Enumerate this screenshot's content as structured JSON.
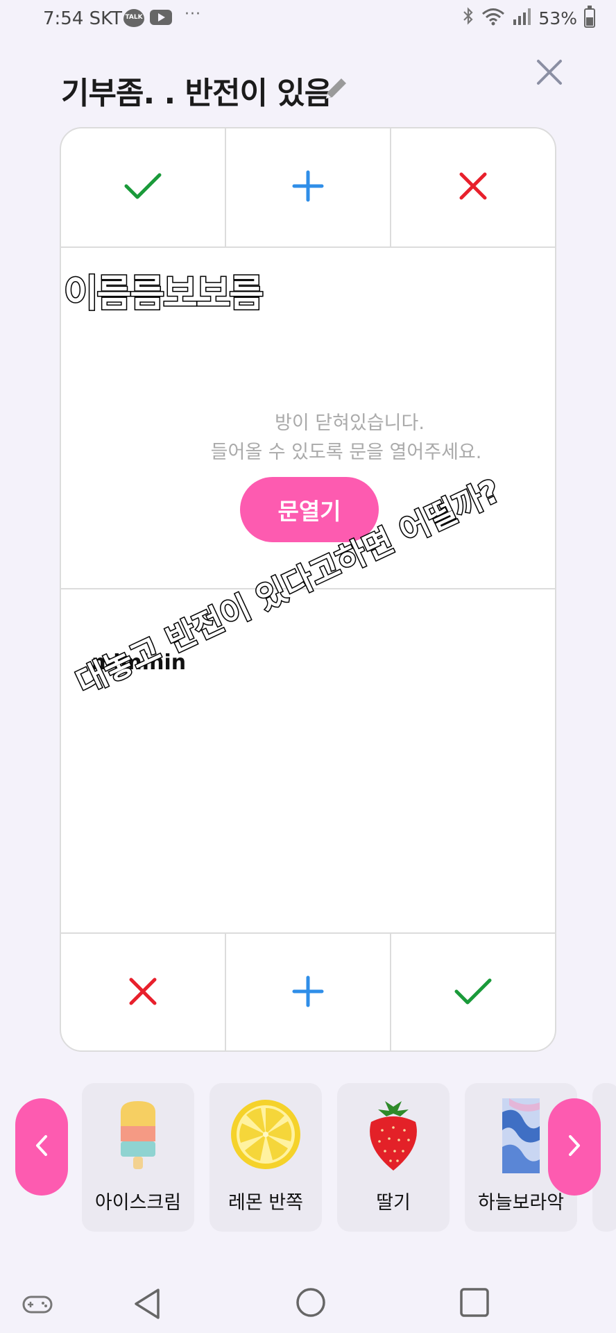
{
  "status_bar": {
    "time": "7:54 SKT",
    "talk_badge": "TALK",
    "more_dots": "···",
    "battery_percent": "53%",
    "icons": [
      "kakaotalk-icon",
      "youtube-icon",
      "bluetooth-icon",
      "wifi-icon",
      "signal-icon",
      "battery-icon"
    ]
  },
  "header": {
    "title": "기부좀. . 반전이 있음",
    "edit_icon": "pencil-icon",
    "close_icon": "close-icon"
  },
  "card": {
    "top_actions": [
      {
        "icon": "check-icon",
        "color": "#1a9a3a"
      },
      {
        "icon": "plus-icon",
        "color": "#2f8ee8"
      },
      {
        "icon": "x-icon",
        "color": "#e8202c"
      }
    ],
    "closed_message_line1": "방이 닫혀있습니다.",
    "closed_message_line2": "들어올 수 있도록 문을 열어주세요.",
    "open_door_label": "문열기",
    "nickname": "miminin",
    "bottom_actions": [
      {
        "icon": "x-icon",
        "color": "#e8202c"
      },
      {
        "icon": "plus-icon",
        "color": "#2f8ee8"
      },
      {
        "icon": "check-icon",
        "color": "#1a9a3a"
      }
    ]
  },
  "captions": {
    "caption_1": "이름름보보름",
    "caption_2": "대놓고 반전이 있다고하면 어떨까?"
  },
  "carousel": {
    "prev_icon": "chevron-left-icon",
    "next_icon": "chevron-right-icon",
    "items": [
      {
        "label": "아이스크림",
        "icon": "ice-pop-icon"
      },
      {
        "label": "레몬 반쪽",
        "icon": "lemon-half-icon"
      },
      {
        "label": "딸기",
        "icon": "strawberry-icon"
      },
      {
        "label": "하늘보라악",
        "icon": "sky-purple-pattern-icon"
      }
    ]
  },
  "navigation_bar": {
    "icons": [
      "game-launcher-icon",
      "back-icon",
      "home-icon",
      "recents-icon"
    ]
  },
  "accent_color": "#fd5bb0"
}
